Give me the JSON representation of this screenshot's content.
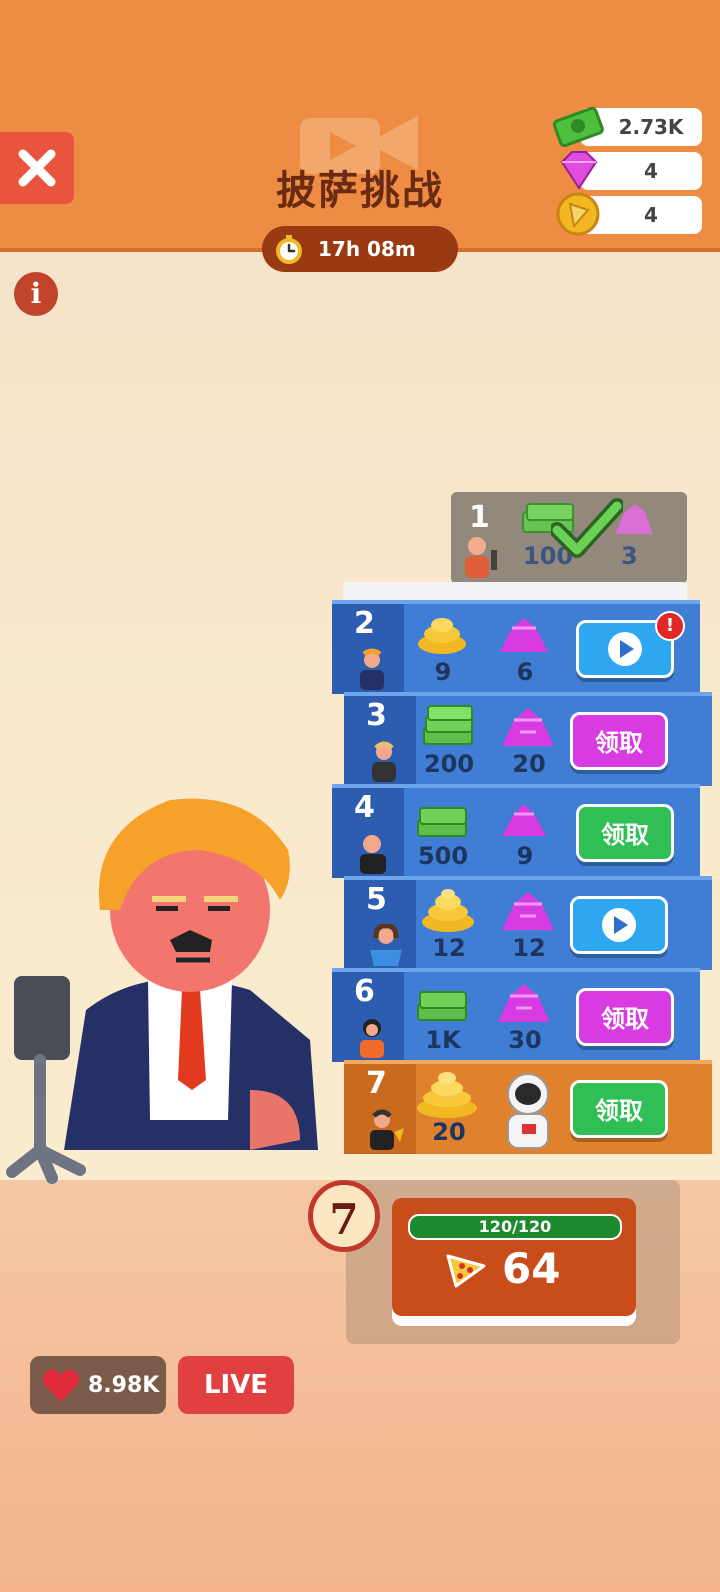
{
  "header": {
    "title": "披萨挑战",
    "timer": "17h 08m",
    "currencies": [
      {
        "name": "cash",
        "value": "2.73K"
      },
      {
        "name": "gems",
        "value": "4"
      },
      {
        "name": "pizza-coins",
        "value": "4"
      }
    ]
  },
  "tiers": [
    {
      "level": "1",
      "reward1": "100",
      "reward2": "3",
      "status": "claimed"
    },
    {
      "level": "2",
      "reward1": "9",
      "reward2": "6",
      "action": "watch"
    },
    {
      "level": "3",
      "reward1": "200",
      "reward2": "20",
      "action": "领取"
    },
    {
      "level": "4",
      "reward1": "500",
      "reward2": "9",
      "action": "领取"
    },
    {
      "level": "5",
      "reward1": "12",
      "reward2": "12",
      "action": "watch"
    },
    {
      "level": "6",
      "reward1": "1K",
      "reward2": "30",
      "action": "领取"
    },
    {
      "level": "7",
      "reward1": "20",
      "action": "领取"
    }
  ],
  "pizza": {
    "level": "7",
    "progress": "120/120",
    "count": "64"
  },
  "footer": {
    "likes": "8.98K",
    "live_label": "LIVE"
  },
  "colors": {
    "header": "#ee8c43",
    "tier_blue": "#3f7ed4",
    "tier_orange": "#e0822d",
    "claim_pink": "#d93be3",
    "claim_green": "#2fbf55"
  }
}
